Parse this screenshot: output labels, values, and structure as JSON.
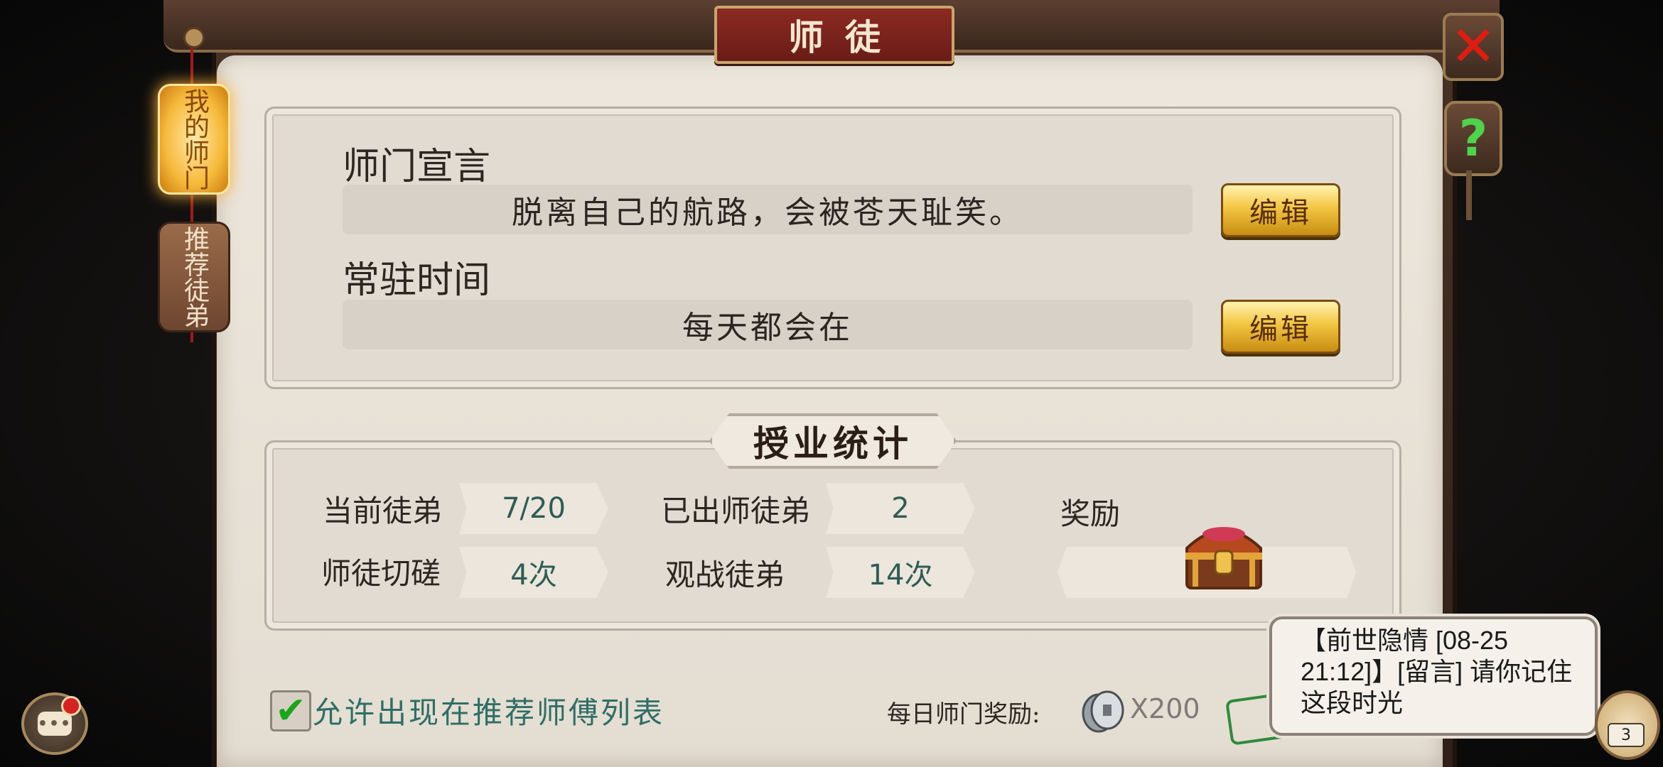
{
  "window": {
    "title": "师徒"
  },
  "side_tabs": [
    {
      "label": "我的师门",
      "active": true
    },
    {
      "label": "推荐徒弟",
      "active": false
    }
  ],
  "declaration": {
    "label": "师门宣言",
    "value": "脱离自己的航路，会被苍天耻笑。",
    "edit_label": "编辑"
  },
  "resident_time": {
    "label": "常驻时间",
    "value": "每天都会在",
    "edit_label": "编辑"
  },
  "stats": {
    "title": "授业统计",
    "current_disciples_label": "当前徒弟",
    "current_disciples_value": "7/20",
    "graduated_label": "已出师徒弟",
    "graduated_value": "2",
    "reward_label": "奖励",
    "sparring_label": "师徒切磋",
    "sparring_value": "4次",
    "spectate_label": "观战徒弟",
    "spectate_value": "14次"
  },
  "bottom": {
    "allow_text": "允许出现在推荐师傅列表",
    "allow_checked": true,
    "daily_reward_label": "每日师门奖励:",
    "daily_reward_amount": "X200"
  },
  "chat": {
    "icon_text": "•••"
  },
  "notification": {
    "text": "【前世隐情 [08-25 21:12]】[留言] 请你记住这段时光"
  },
  "avatar": {
    "badge": "3"
  },
  "icons": {
    "close": "close-icon",
    "help": "help-icon",
    "chat": "chat-icon",
    "chest": "treasure-chest-icon",
    "coin": "silver-coin-icon",
    "check": "checkmark-icon"
  },
  "colors": {
    "accent_gold": "#f2c642",
    "title_red": "#8c2a22",
    "value_teal": "#2f5b55",
    "close_red": "#e11b12",
    "help_green": "#4fd24c"
  }
}
